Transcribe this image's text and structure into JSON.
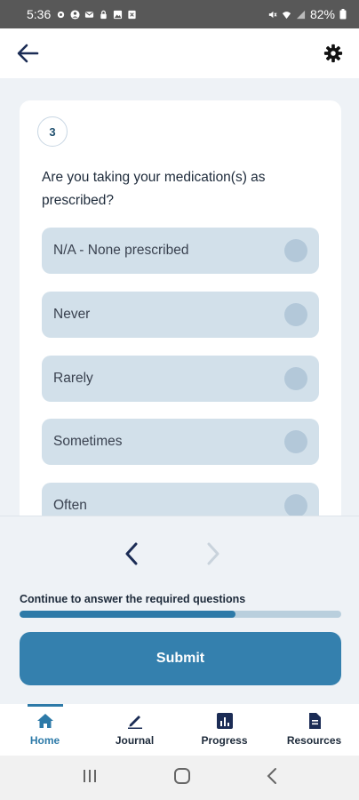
{
  "status_bar": {
    "time": "5:36",
    "battery": "82%"
  },
  "top_bar": {
    "back_icon": "back-arrow-icon",
    "settings_icon": "gear-icon"
  },
  "question": {
    "number": "3",
    "text": "Are you taking your medication(s) as prescribed?",
    "options": [
      {
        "label": "N/A - None prescribed"
      },
      {
        "label": "Never"
      },
      {
        "label": "Rarely"
      },
      {
        "label": "Sometimes"
      },
      {
        "label": "Often"
      }
    ]
  },
  "footer": {
    "progress_label": "Continue to answer the required questions",
    "progress_fraction": 0.67,
    "submit_label": "Submit"
  },
  "tabs": [
    {
      "label": "Home",
      "icon": "home-icon",
      "active": true
    },
    {
      "label": "Journal",
      "icon": "pencil-icon",
      "active": false
    },
    {
      "label": "Progress",
      "icon": "chart-icon",
      "active": false
    },
    {
      "label": "Resources",
      "icon": "document-icon",
      "active": false
    }
  ],
  "colors": {
    "accent": "#2d7aa8",
    "option_bg": "#d2e0ea",
    "submit_bg": "#3480ae"
  }
}
